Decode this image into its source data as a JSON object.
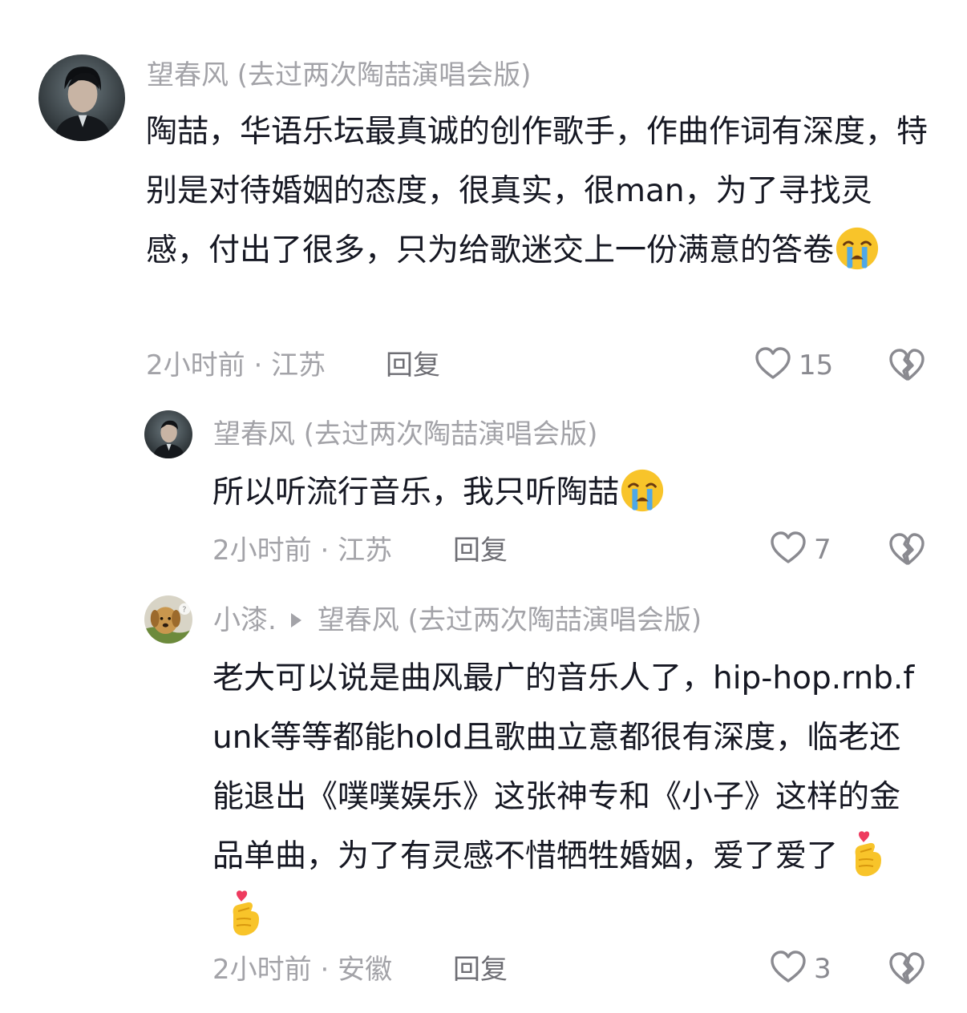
{
  "comments": [
    {
      "username": "望春风 (去过两次陶喆演唱会版)",
      "text": "陶喆，华语乐坛最真诚的创作歌手，作曲作词有深度，特别是对待婚姻的态度，很真实，很man，为了寻找灵感，付出了很多，只为给歌迷交上一份满意的答卷",
      "emoji": "loudly-crying-face",
      "time": "2小时前",
      "location": "江苏",
      "reply_label": "回复",
      "likes": "15"
    },
    {
      "username": "望春风 (去过两次陶喆演唱会版)",
      "text": "所以听流行音乐，我只听陶喆",
      "emoji": "loudly-crying-face",
      "time": "2小时前",
      "location": "江苏",
      "reply_label": "回复",
      "likes": "7"
    },
    {
      "username": "小漆.",
      "reply_to": "望春风 (去过两次陶喆演唱会版)",
      "text": "老大可以说是曲风最广的音乐人了，hip-hop.rnb.funk等等都能hold且歌曲立意都很有深度，临老还能退出《噗噗娱乐》这张神专和《小子》这样的金品单曲，为了有灵感不惜牺牲婚姻，爱了爱了",
      "emoji": "finger-heart",
      "time": "2小时前",
      "location": "安徽",
      "reply_label": "回复",
      "likes": "3"
    }
  ],
  "separator": "·",
  "colors": {
    "text": "#161823",
    "secondary": "#a3a3a8",
    "reply": "#6e6e74"
  }
}
